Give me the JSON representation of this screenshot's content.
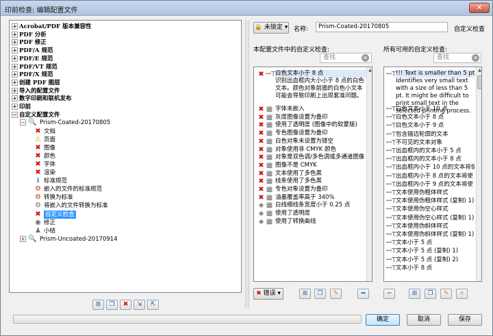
{
  "window": {
    "title": "印前检查: 编辑配置文件",
    "close": "✕"
  },
  "tree": {
    "top_items": [
      "Acrobat/PDF 版本兼容性",
      "PDF 分析",
      "PDF 修正",
      "PDF/A 规范",
      "PDF/E 规范",
      "PDF/VT 规范",
      "PDF/X 规范",
      "创建 PDF 图层",
      "导入的配置文件",
      "数字印刷和联机发布",
      "印前",
      "自定义配置文件"
    ],
    "profile_1": "Prism-Coated-20170805",
    "children": [
      "文档",
      "页面",
      "图像",
      "颜色",
      "字体",
      "渲染",
      "标准规范",
      "嵌入的文件的标准规范",
      "转换为标准",
      "将嵌入的文件转换为标准",
      "自定义检查",
      "修正",
      "小结"
    ],
    "profile_2": "Prism-Uncoated-20170914"
  },
  "header": {
    "lock_label": "未锁定",
    "name_label": "名称:",
    "name_value": "Prism-Coated-20170805",
    "custom_check_label": "自定义检查"
  },
  "left_list": {
    "title": "本配置文件中的自定义检查:",
    "search_placeholder": "查找",
    "selected": {
      "label": "白色文本小于 8 点",
      "description": "识别出血框内大小小于 8 点的白色文本。颜色对象前面的白色小文本可能会导致印刷上出现套准问题。"
    },
    "items": [
      "字体未嵌入",
      "灰度图像设置为叠印",
      "使用了透明度 (图像中的软蒙版)",
      "专色图像设置为叠印",
      "白色对象未设置为镂空",
      "对象使用非 CMYK 颜色",
      "对象是双色调/多色调或多通道图像",
      "图像不是 CMYK",
      "文本使用了多色黑",
      "线条使用了多色黑",
      "专色对象设置为叠印",
      "油墨覆盖率高于 340%",
      "白线细线条宽度小于 0.25 点",
      "使用了透明度",
      "使用了转换曲线"
    ],
    "error_button": "错误"
  },
  "right_list": {
    "title": "所有可用的自定义检查:",
    "search_placeholder": "查找",
    "selected": {
      "label": "!!! Text is smaller than 5 pt",
      "description": "Identifies very small text with a size of less than 5 pt. It might be difficult to print small text in the selected printing process."
    },
    "items": [
      "白色文本小于 10 点",
      "白色文本小于 8 点",
      "白色文本小于 9 点",
      "包含描边轮廓的文本",
      "不可见的文本对象",
      "出血框内的文本小于 5 点",
      "出血框内的文本小于 8 点",
      "出血框内小于 10 点的文本将使",
      "出血框内小于 8 点的文本将使",
      "出血框内小于 9 点的文本将使",
      "文本使用伪粗体样式",
      "文本使用伪粗体样式 (复制) 1)",
      "文本使用伪空心样式",
      "文本使用伪空心样式 (复制) 1)",
      "文本使用伪斜体样式",
      "文本使用伪斜体样式 (复制) 1)",
      "文本小于 5 点",
      "文本小于 5 点 (复制) 1)",
      "文本小于 5 点 (复制) 2)",
      "文本小于 8 点"
    ]
  },
  "footer": {
    "ok": "确定",
    "cancel": "取消",
    "save": "保存"
  }
}
